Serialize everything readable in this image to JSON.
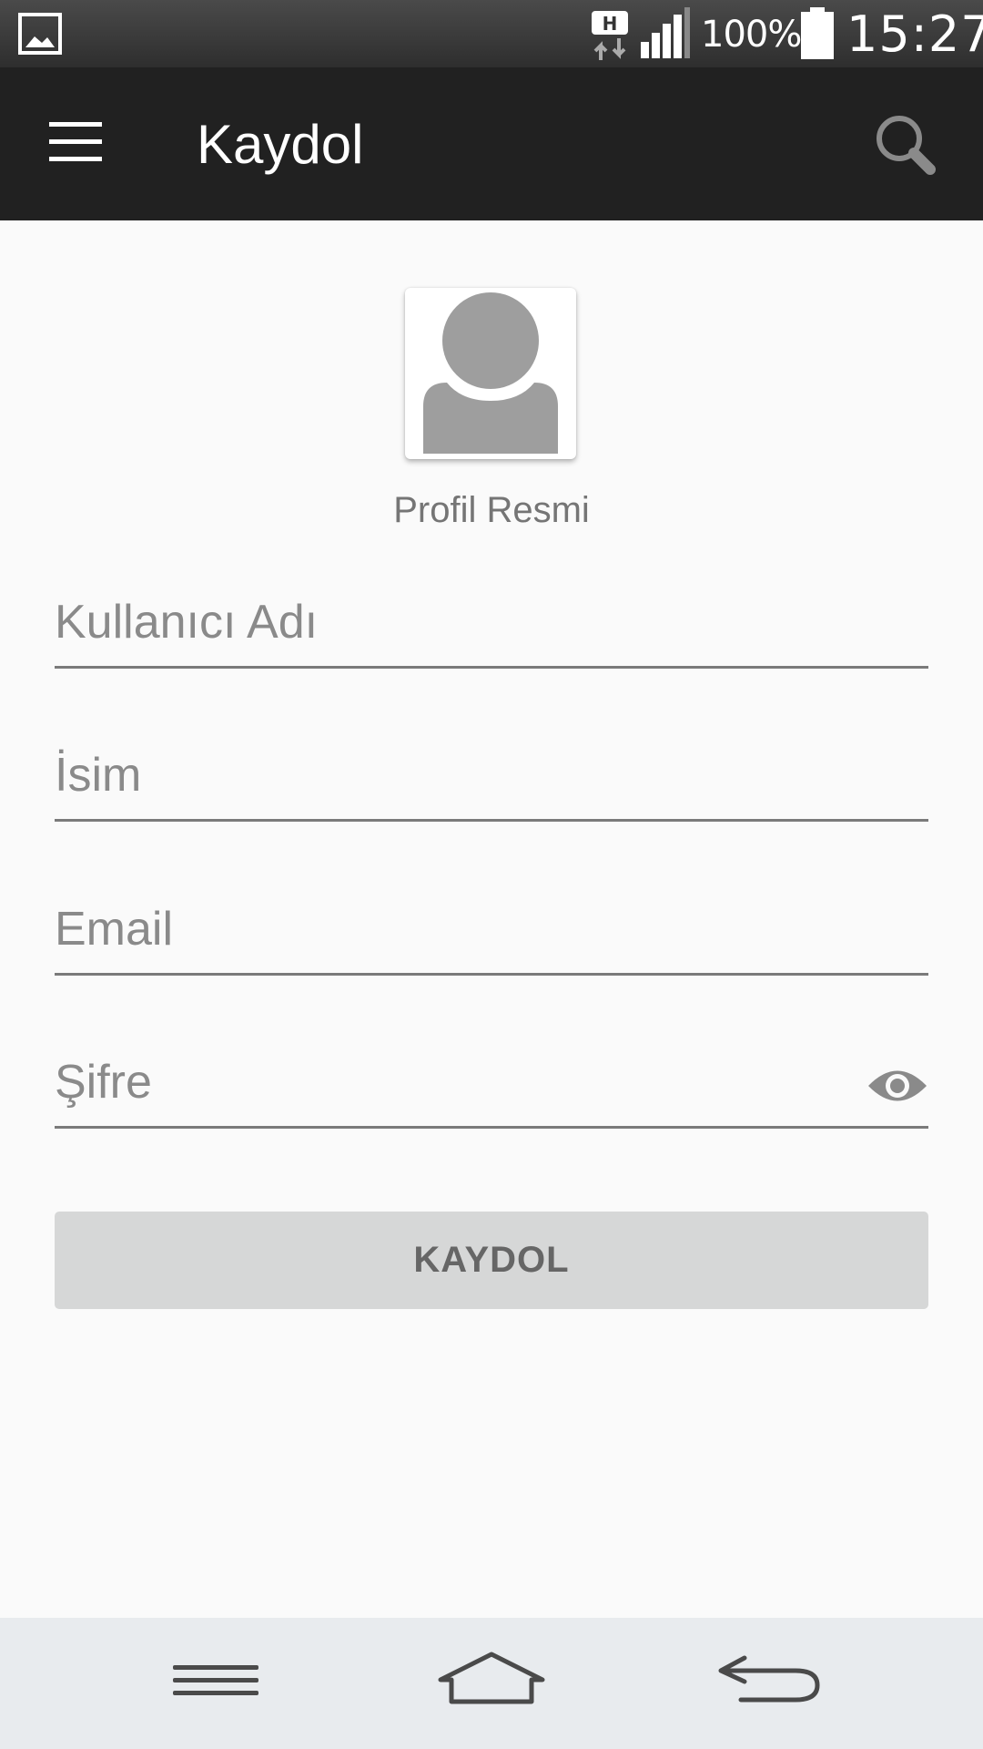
{
  "status_bar": {
    "network_type": "H",
    "battery_percent": "100%",
    "time": "15:27"
  },
  "app_bar": {
    "title": "Kaydol",
    "menu_icon": "hamburger-menu-icon",
    "search_icon": "search-icon"
  },
  "profile": {
    "label": "Profil Resmi",
    "icon": "avatar-placeholder-icon"
  },
  "form": {
    "username_placeholder": "Kullanıcı Adı",
    "name_placeholder": "İsim",
    "email_placeholder": "Email",
    "password_placeholder": "Şifre",
    "password_toggle_icon": "eye-icon",
    "submit_label": "KAYDOL"
  },
  "nav_bar": {
    "menu_icon": "menu-icon",
    "home_icon": "home-icon",
    "back_icon": "back-icon"
  },
  "colors": {
    "app_bar": "#212121",
    "background": "#fafafa",
    "button": "#d6d7d7",
    "icon_grey": "#9e9e9e"
  }
}
